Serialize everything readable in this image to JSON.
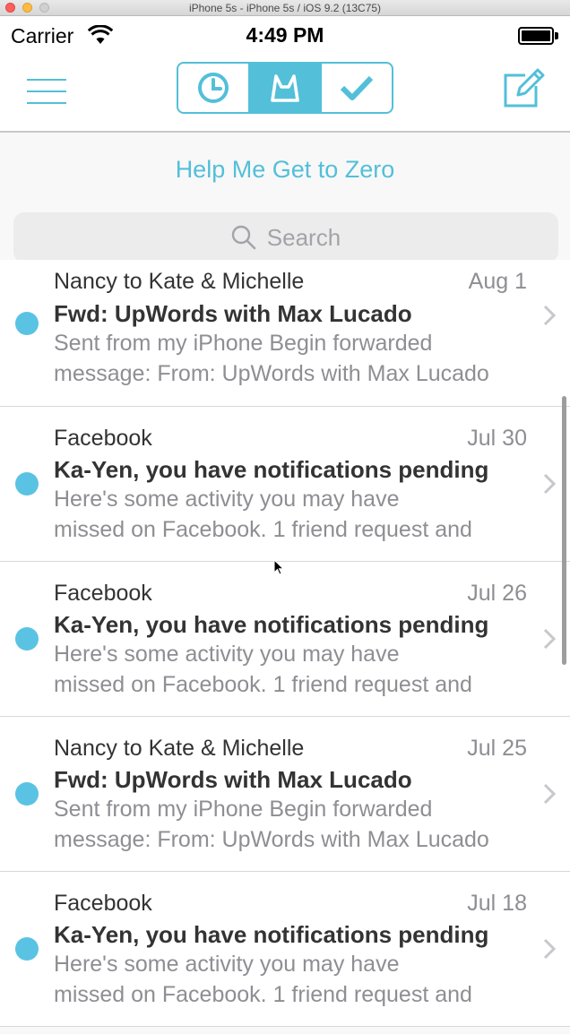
{
  "window": {
    "title": "iPhone 5s - iPhone 5s / iOS 9.2 (13C75)"
  },
  "status_bar": {
    "carrier": "Carrier",
    "time": "4:49 PM"
  },
  "nav": {
    "segments": [
      {
        "name": "later",
        "icon": "clock-icon"
      },
      {
        "name": "inbox",
        "icon": "inbox-icon",
        "active": true
      },
      {
        "name": "done",
        "icon": "check-icon"
      }
    ]
  },
  "help_link": "Help Me Get to Zero",
  "search": {
    "placeholder": "Search"
  },
  "colors": {
    "accent": "#53bfd9",
    "unread_dot": "#5ac3e3"
  },
  "emails": [
    {
      "sender": "Nancy to Kate & Michelle",
      "date": "Aug 1",
      "subject": "Fwd: UpWords with Max Lucado",
      "preview_line1": "Sent from my iPhone Begin forwarded",
      "preview_line2": "message: From: UpWords with Max Lucado",
      "unread": true
    },
    {
      "sender": "Facebook",
      "date": "Jul 30",
      "subject": "Ka-Yen, you have notifications pending",
      "preview_line1": "Here's some activity you may have",
      "preview_line2": "missed on Facebook. 1 friend request and",
      "unread": true
    },
    {
      "sender": "Facebook",
      "date": "Jul 26",
      "subject": "Ka-Yen, you have notifications pending",
      "preview_line1": "Here's some activity you may have",
      "preview_line2": "missed on Facebook. 1 friend request and",
      "unread": true
    },
    {
      "sender": "Nancy to Kate & Michelle",
      "date": "Jul 25",
      "subject": "Fwd: UpWords with Max Lucado",
      "preview_line1": "Sent from my iPhone Begin forwarded",
      "preview_line2": "message: From: UpWords with Max Lucado",
      "unread": true
    },
    {
      "sender": "Facebook",
      "date": "Jul 18",
      "subject": "Ka-Yen, you have notifications pending",
      "preview_line1": "Here's some activity you may have",
      "preview_line2": "missed on Facebook. 1 friend request and",
      "unread": true
    }
  ]
}
